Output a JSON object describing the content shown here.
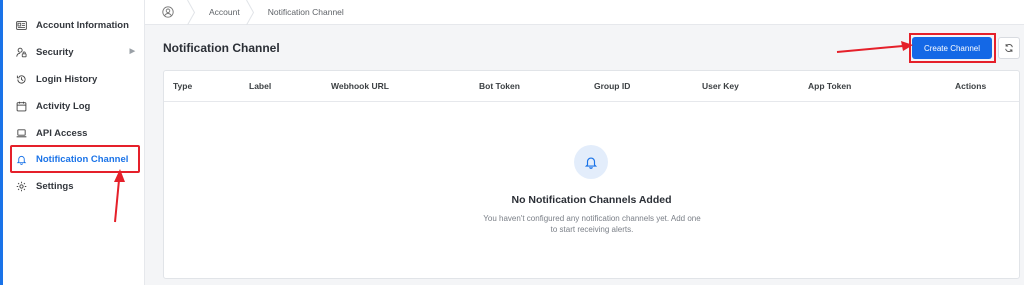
{
  "sidebar": {
    "items": [
      {
        "label": "Account Information",
        "icon": "id-card-icon"
      },
      {
        "label": "Security",
        "icon": "user-lock-icon",
        "has_submenu": true
      },
      {
        "label": "Login History",
        "icon": "history-icon"
      },
      {
        "label": "Activity Log",
        "icon": "calendar-icon"
      },
      {
        "label": "API Access",
        "icon": "laptop-icon"
      },
      {
        "label": "Notification Channel",
        "icon": "bell-icon",
        "active": true
      },
      {
        "label": "Settings",
        "icon": "gear-icon"
      }
    ]
  },
  "breadcrumb": {
    "items": [
      "Account",
      "Notification Channel"
    ]
  },
  "page": {
    "title": "Notification Channel",
    "create_button": "Create Channel",
    "refresh_icon": "refresh-icon"
  },
  "table": {
    "columns": [
      "Type",
      "Label",
      "Webhook URL",
      "Bot Token",
      "Group ID",
      "User Key",
      "App Token",
      "Actions"
    ]
  },
  "empty_state": {
    "icon": "bell-icon",
    "title": "No Notification Channels Added",
    "description": "You haven't configured any notification channels yet. Add one to start receiving alerts."
  },
  "colors": {
    "accent": "#1468e6",
    "highlight_annotation": "#e5202a",
    "empty_icon_bg": "#e3edfb"
  }
}
